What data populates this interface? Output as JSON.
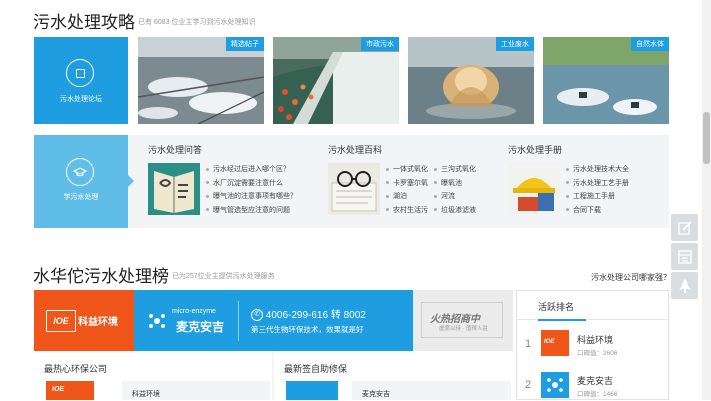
{
  "guide": {
    "title": "污水处理攻略",
    "subtitle": "已有 6083 位业主学习到污水处理知识",
    "forum_tile_label": "污水处理论坛",
    "learn_tile_label": "学污水处理",
    "photos": [
      {
        "tag": "精选帖子"
      },
      {
        "tag": "市政污水"
      },
      {
        "tag": "工业废水"
      },
      {
        "tag": "自然水体"
      }
    ],
    "qa": {
      "title": "污水处理问答",
      "links": [
        "污水经过后进入哪个区？",
        "水厂沉淀需要注意什么",
        "曝气池的注意事项有哪些？",
        "曝气管选型应注意的问题"
      ]
    },
    "encyclopedia": {
      "title": "污水处理百科",
      "col1": [
        "一体式氧化",
        "卡罗塞尔氧",
        "湖泊",
        "农村生活污"
      ],
      "col2": [
        "三沟式氧化",
        "曝氧池",
        "河流",
        "垃圾渗滤液"
      ]
    },
    "manual": {
      "title": "污水处理手册",
      "links": [
        "污水处理技术大全",
        "污水处理工艺手册",
        "工程施工手册",
        "合同下载"
      ]
    }
  },
  "ranking": {
    "title": "水华佗污水处理榜",
    "subtitle": "已为257位业主提供污水处理服务",
    "help_link": "污水处理公司哪家强？",
    "ads": {
      "kyhj": "科益环境",
      "micro_en": "micro-enzyme",
      "micro_cn": "麦克安吉",
      "phone": "4006-299-616 转 8002",
      "slogan": "第三代生物环保技术，效果就是好",
      "recruit_main": "火热招商中",
      "recruit_sub": "虚席以待 · 值得入驻"
    },
    "popular_title": "最热心环保公司",
    "popular_first": "科益环境",
    "recent_title": "最新签自助修保",
    "recent_first": "麦克安吉",
    "active": {
      "title": "活跃排名",
      "items": [
        {
          "rank": "1",
          "name": "科益环境",
          "score": "口碑值：2606"
        },
        {
          "rank": "2",
          "name": "麦克安吉",
          "score": "口碑值：1466"
        }
      ]
    }
  },
  "colors": {
    "accent_blue": "#1e9ee0",
    "brand_orange": "#f0561a",
    "panel_gray": "#f3f4f5"
  }
}
